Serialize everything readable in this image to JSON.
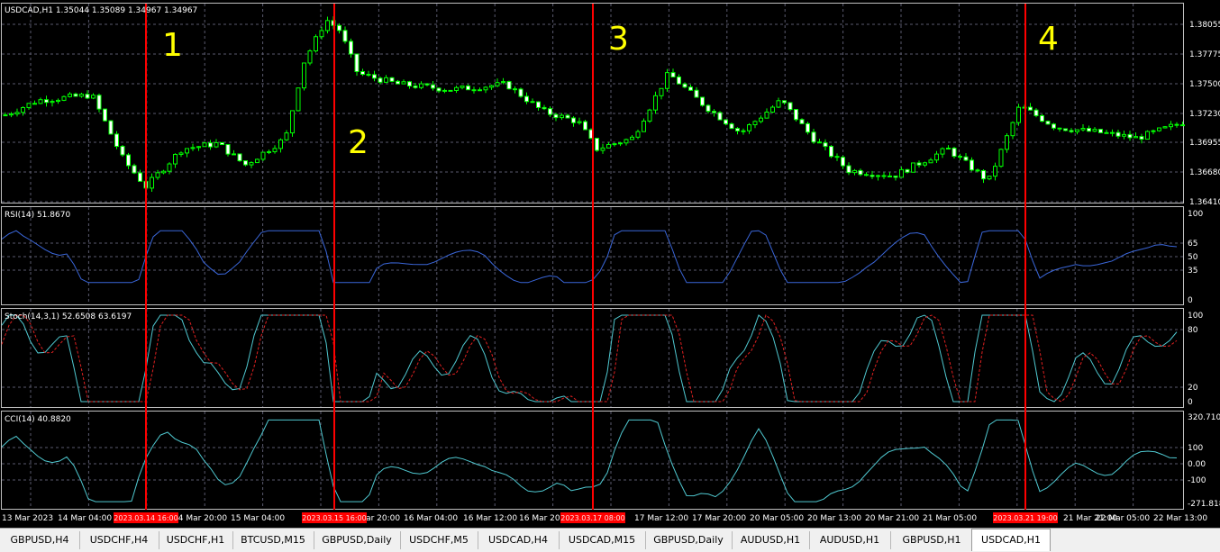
{
  "main": {
    "header": "USDCAD,H1  1.35044 1.35089 1.34967 1.34967",
    "price_ticks": [
      "1.38055",
      "1.37775",
      "1.37500",
      "1.37230",
      "1.36955",
      "1.36680",
      "1.36410"
    ],
    "annotations": [
      "1",
      "2",
      "3",
      "4"
    ]
  },
  "rsi": {
    "header": "RSI(14) 51.8670",
    "ticks": [
      "100",
      "65",
      "50",
      "35",
      "0"
    ]
  },
  "stoch": {
    "header": "Stoch(14,3,1) 52.6508 63.6197",
    "ticks": [
      "100",
      "80",
      "20",
      "0"
    ]
  },
  "cci": {
    "header": "CCI(14) 40.8820",
    "ticks": [
      "320.7102",
      "100",
      "0.00",
      "-100",
      "-271.818"
    ]
  },
  "time_axis": [
    "13 Mar 2023",
    "14 Mar 04:00",
    "14 Mar 20:00",
    "15 Mar 04:00",
    "15 Mar 20:00",
    "16 Mar 04:00",
    "16 Mar 12:00",
    "16 Mar 20",
    "17 Mar 12:00",
    "17 Mar 20:00",
    "20 Mar 05:00",
    "20 Mar 13:00",
    "20 Mar 21:00",
    "21 Mar 05:00",
    "21 Mar 21:00",
    "22 Mar 05:00",
    "22 Mar 13:00"
  ],
  "markers": [
    "2023.03.14 16:00",
    "2023.03.15 16:00",
    "2023.03.17 08:00",
    "2023.03.21 19:00"
  ],
  "tabs": [
    "GBPUSD,H4",
    "USDCHF,H4",
    "USDCHF,H1",
    "BTCUSD,M15",
    "GBPUSD,Daily",
    "USDCHF,M5",
    "USDCAD,H4",
    "USDCAD,M15",
    "GBPUSD,Daily",
    "AUDUSD,H1",
    "AUDUSD,H1",
    "GBPUSD,H1",
    "USDCAD,H1"
  ],
  "active_tab": "USDCAD,H1",
  "colors": {
    "bull": "#00ff00",
    "bear": "#ffffff",
    "rsi": "#3a66d9",
    "stoch_main": "#4fc8d0",
    "stoch_signal": "#e02020",
    "cci": "#4fc8d0",
    "marker": "#ff0000",
    "annotation": "#ffff00",
    "grid": "#5a5a6e"
  }
}
